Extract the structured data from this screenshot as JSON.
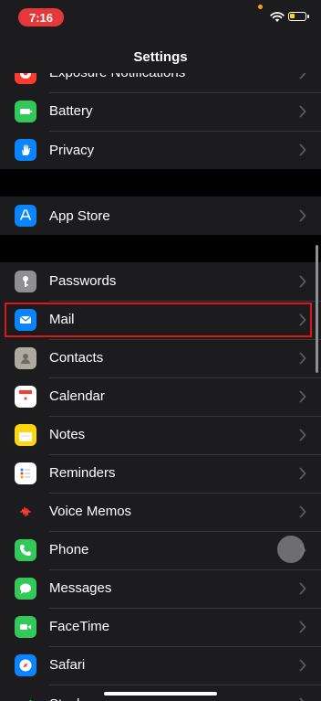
{
  "status": {
    "time": "7:16"
  },
  "nav": {
    "title": "Settings"
  },
  "groups": [
    {
      "items": [
        {
          "label": "Exposure Notifications",
          "icon": "exposure-icon",
          "color": "#ff3b30"
        },
        {
          "label": "Battery",
          "icon": "battery-icon",
          "color": "#34c759"
        },
        {
          "label": "Privacy",
          "icon": "hand-icon",
          "color": "#0a84ff"
        }
      ]
    },
    {
      "items": [
        {
          "label": "App Store",
          "icon": "app-store-icon",
          "color": "#0a84ff"
        }
      ]
    },
    {
      "items": [
        {
          "label": "Passwords",
          "icon": "key-icon",
          "color": "#8e8e93"
        },
        {
          "label": "Mail",
          "icon": "mail-icon",
          "color": "#0a84ff"
        },
        {
          "label": "Contacts",
          "icon": "contacts-icon",
          "color": "#b0a99f"
        },
        {
          "label": "Calendar",
          "icon": "calendar-icon",
          "color": "#ffffff"
        },
        {
          "label": "Notes",
          "icon": "notes-icon",
          "color": "#ffd60a"
        },
        {
          "label": "Reminders",
          "icon": "reminders-icon",
          "color": "#ffffff"
        },
        {
          "label": "Voice Memos",
          "icon": "voice-memos-icon",
          "color": "#1c1c1e"
        },
        {
          "label": "Phone",
          "icon": "phone-icon",
          "color": "#34c759"
        },
        {
          "label": "Messages",
          "icon": "messages-icon",
          "color": "#34c759"
        },
        {
          "label": "FaceTime",
          "icon": "facetime-icon",
          "color": "#34c759"
        },
        {
          "label": "Safari",
          "icon": "safari-icon",
          "color": "#0a84ff"
        },
        {
          "label": "Stocks",
          "icon": "stocks-icon",
          "color": "#1c1c1e"
        }
      ]
    }
  ]
}
